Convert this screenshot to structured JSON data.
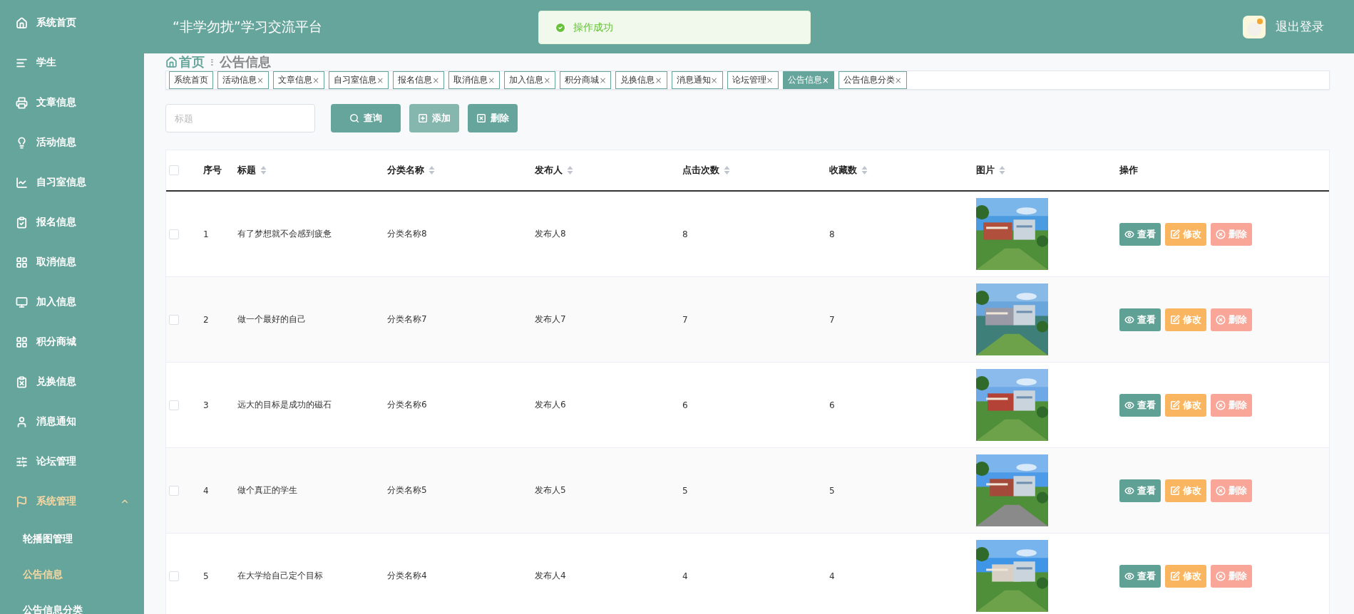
{
  "sidebar": {
    "items": [
      {
        "label": "系统首页",
        "selected": false
      },
      {
        "label": "学生",
        "selected": false
      },
      {
        "label": "文章信息",
        "selected": false
      },
      {
        "label": "活动信息",
        "selected": false
      },
      {
        "label": "自习室信息",
        "selected": false
      },
      {
        "label": "报名信息",
        "selected": false
      },
      {
        "label": "取消信息",
        "selected": false
      },
      {
        "label": "加入信息",
        "selected": false
      },
      {
        "label": "积分商城",
        "selected": false
      },
      {
        "label": "兑换信息",
        "selected": false
      },
      {
        "label": "消息通知",
        "selected": false
      },
      {
        "label": "论坛管理",
        "selected": false
      },
      {
        "label": "系统管理",
        "selected": false,
        "expanded": true,
        "children": [
          {
            "label": "轮播图管理",
            "selected": false
          },
          {
            "label": "公告信息",
            "selected": true
          },
          {
            "label": "公告信息分类",
            "selected": false
          }
        ]
      }
    ]
  },
  "header": {
    "title": "“非学勿扰”学习交流平台",
    "logout": "退出登录"
  },
  "toast": {
    "message": "操作成功"
  },
  "breadcrumb": {
    "home": "首页",
    "separator": "ⵗ",
    "current": "公告信息"
  },
  "tags": [
    {
      "label": "系统首页",
      "closable": false,
      "selected": false
    },
    {
      "label": "活动信息",
      "closable": true,
      "selected": false
    },
    {
      "label": "文章信息",
      "closable": true,
      "selected": false
    },
    {
      "label": "自习室信息",
      "closable": true,
      "selected": false
    },
    {
      "label": "报名信息",
      "closable": true,
      "selected": false
    },
    {
      "label": "取消信息",
      "closable": true,
      "selected": false
    },
    {
      "label": "加入信息",
      "closable": true,
      "selected": false
    },
    {
      "label": "积分商城",
      "closable": true,
      "selected": false
    },
    {
      "label": "兑换信息",
      "closable": true,
      "selected": false
    },
    {
      "label": "消息通知",
      "closable": true,
      "selected": false
    },
    {
      "label": "论坛管理",
      "closable": true,
      "selected": false
    },
    {
      "label": "公告信息",
      "closable": true,
      "selected": true
    },
    {
      "label": "公告信息分类",
      "closable": true,
      "selected": false
    }
  ],
  "close_mark": "×",
  "search": {
    "placeholder": "标题"
  },
  "toolbar": [
    {
      "kind": "search",
      "label": "查询",
      "hovered": false
    },
    {
      "kind": "add",
      "label": "添加",
      "hovered": true
    },
    {
      "kind": "delete",
      "label": "删除",
      "hovered": false
    }
  ],
  "table": {
    "all_checked": false,
    "columns": [
      {
        "label": "序号",
        "sortable": false
      },
      {
        "label": "标题",
        "sortable": true
      },
      {
        "label": "分类名称",
        "sortable": true
      },
      {
        "label": "发布人",
        "sortable": true
      },
      {
        "label": "点击次数",
        "sortable": true
      },
      {
        "label": "收藏数",
        "sortable": true
      },
      {
        "label": "图片",
        "sortable": true
      },
      {
        "label": "操作",
        "sortable": false
      }
    ],
    "rows": [
      {
        "checked": false,
        "cells": [
          "1",
          "有了梦想就不会感到疲惫",
          "分类名称8",
          "发布人8",
          "8",
          "8"
        ],
        "actions": [
          {
            "kind": "view",
            "label": "查看"
          },
          {
            "kind": "edit",
            "label": "修改"
          },
          {
            "kind": "delete",
            "label": "删除"
          }
        ]
      },
      {
        "checked": false,
        "cells": [
          "2",
          "做一个最好的自己",
          "分类名称7",
          "发布人7",
          "7",
          "7"
        ],
        "actions": [
          {
            "kind": "view",
            "label": "查看"
          },
          {
            "kind": "edit",
            "label": "修改"
          },
          {
            "kind": "delete",
            "label": "删除"
          }
        ]
      },
      {
        "checked": false,
        "cells": [
          "3",
          "远大的目标是成功的磁石",
          "分类名称6",
          "发布人6",
          "6",
          "6"
        ],
        "actions": [
          {
            "kind": "view",
            "label": "查看"
          },
          {
            "kind": "edit",
            "label": "修改"
          },
          {
            "kind": "delete",
            "label": "删除"
          }
        ]
      },
      {
        "checked": false,
        "cells": [
          "4",
          "做个真正的学生",
          "分类名称5",
          "发布人5",
          "5",
          "5"
        ],
        "actions": [
          {
            "kind": "view",
            "label": "查看"
          },
          {
            "kind": "edit",
            "label": "修改"
          },
          {
            "kind": "delete",
            "label": "删除"
          }
        ]
      },
      {
        "checked": false,
        "cells": [
          "5",
          "在大学给自己定个目标",
          "分类名称4",
          "发布人4",
          "4",
          "4"
        ],
        "actions": [
          {
            "kind": "view",
            "label": "查看"
          },
          {
            "kind": "edit",
            "label": "修改"
          },
          {
            "kind": "delete",
            "label": "删除"
          }
        ]
      }
    ]
  }
}
